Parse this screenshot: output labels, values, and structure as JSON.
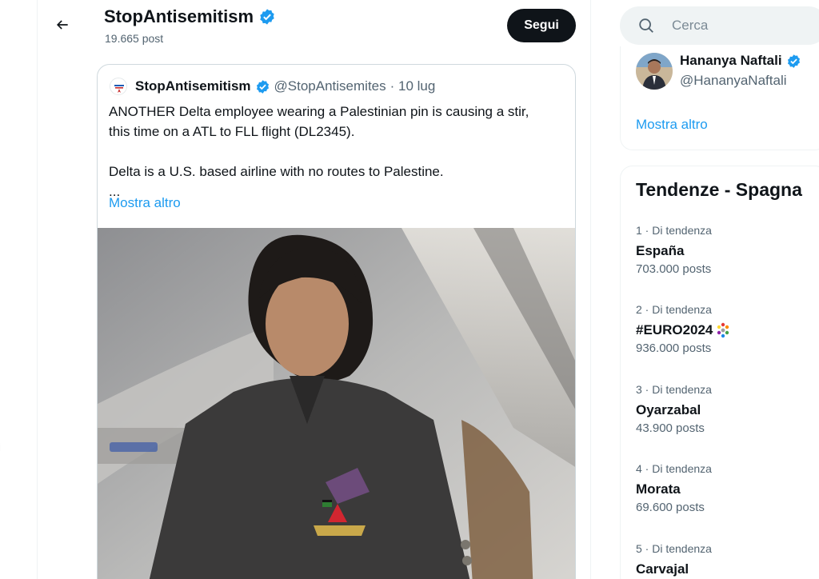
{
  "left_rail": {
    "glyph": "i"
  },
  "header": {
    "profile_name": "StopAntisemitism",
    "post_count": "19.665 post",
    "follow_label": "Segui"
  },
  "quote": {
    "name": "StopAntisemitism",
    "handle": "@StopAntisemites",
    "date": "· 10 lug",
    "line1": "ANOTHER Delta employee wearing a Palestinian pin is causing a stir,",
    "line2": "this time on a ATL to FLL flight (DL2345).",
    "line3": "Delta is a U.S. based airline with no routes to Palestine.",
    "ellipsis": "...",
    "show_more": "Mostra altro"
  },
  "search": {
    "placeholder": "Cerca"
  },
  "who_to_follow": {
    "name": "Hananya Naftali",
    "handle": "@HananyaNaftali",
    "show_more": "Mostra altro"
  },
  "trends": {
    "title": "Tendenze - Spagna",
    "items": [
      {
        "meta": "1 · Di tendenza",
        "name": "España",
        "posts": "703.000 posts"
      },
      {
        "meta": "2 · Di tendenza",
        "name": "#EURO2024",
        "posts": "936.000 posts"
      },
      {
        "meta": "3 · Di tendenza",
        "name": "Oyarzabal",
        "posts": "43.900 posts"
      },
      {
        "meta": "4 · Di tendenza",
        "name": "Morata",
        "posts": "69.600 posts"
      },
      {
        "meta": "5 · Di tendenza",
        "name": "Carvajal",
        "posts": ""
      }
    ]
  },
  "colors": {
    "accent": "#1d9bf0",
    "text": "#0f1419",
    "muted": "#536471",
    "follow_bg": "#0f1419",
    "verified": "#1d9bf0"
  },
  "icons": [
    "back-arrow-icon",
    "verified-badge-icon",
    "search-icon",
    "euro2024-icon"
  ]
}
